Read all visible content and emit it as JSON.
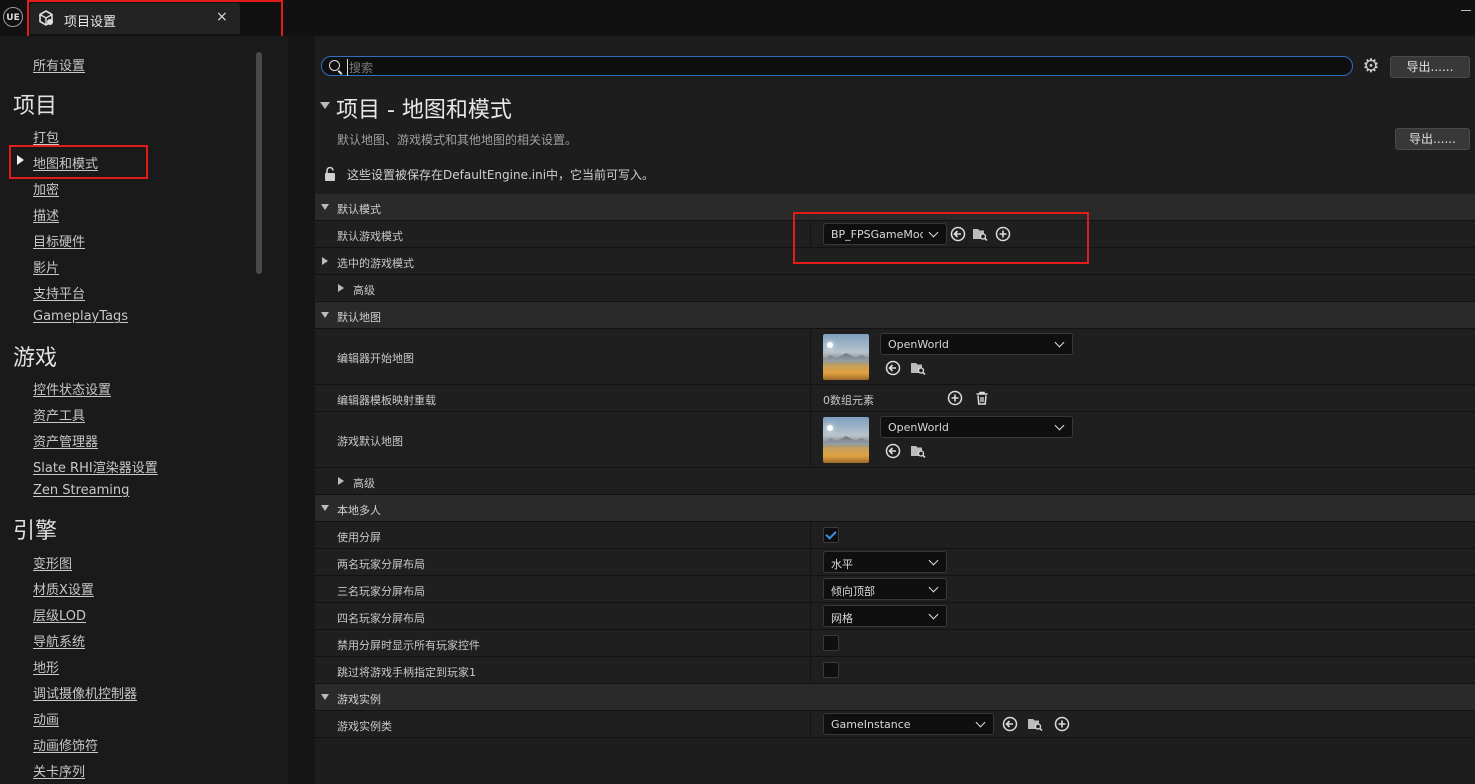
{
  "window": {
    "tab_title": "项目设置",
    "tab_close": "×",
    "logo": "UE"
  },
  "sidebar": {
    "all_settings": "所有设置",
    "sections": [
      {
        "title": "项目",
        "items": [
          "打包",
          "地图和模式",
          "加密",
          "描述",
          "目标硬件",
          "影片",
          "支持平台",
          "GameplayTags"
        ]
      },
      {
        "title": "游戏",
        "items": [
          "控件状态设置",
          "资产工具",
          "资产管理器",
          "Slate RHI渲染器设置",
          "Zen Streaming"
        ]
      },
      {
        "title": "引擎",
        "items": [
          "变形图",
          "材质X设置",
          "层级LOD",
          "导航系统",
          "地形",
          "调试摄像机控制器",
          "动画",
          "动画修饰符",
          "关卡序列"
        ]
      }
    ],
    "selected_item": "地图和模式"
  },
  "toolbar": {
    "search_placeholder": "搜索",
    "export_label": "导出......",
    "gear_icon": "settings-gear-icon"
  },
  "page": {
    "title": "项目 - 地图和模式",
    "description": "默认地图、游戏模式和其他地图的相关设置。",
    "export_label": "导出......",
    "save_note": "这些设置被保存在DefaultEngine.ini中，它当前可写入。"
  },
  "settings": {
    "default_modes": {
      "title": "默认模式",
      "default_game_mode_label": "默认游戏模式",
      "default_game_mode_value": "BP_FPSGameMode",
      "selected_game_mode_label": "选中的游戏模式",
      "advanced_label": "高级"
    },
    "default_maps": {
      "title": "默认地图",
      "editor_startup_map_label": "编辑器开始地图",
      "editor_startup_map_value": "OpenWorld",
      "editor_template_label": "编辑器模板映射重载",
      "editor_template_value": "0数组元素",
      "game_default_map_label": "游戏默认地图",
      "game_default_map_value": "OpenWorld",
      "advanced_label": "高级"
    },
    "local_multiplayer": {
      "title": "本地多人",
      "use_splitscreen_label": "使用分屏",
      "use_splitscreen_checked": true,
      "two_player_label": "两名玩家分屏布局",
      "two_player_value": "水平",
      "three_player_label": "三名玩家分屏布局",
      "three_player_value": "倾向顶部",
      "four_player_label": "四名玩家分屏布局",
      "four_player_value": "网格",
      "disable_splitscreen_label": "禁用分屏时显示所有玩家控件",
      "disable_splitscreen_checked": false,
      "skip_gamepad_label": "跳过将游戏手柄指定到玩家1",
      "skip_gamepad_checked": false
    },
    "game_instance": {
      "title": "游戏实例",
      "class_label": "游戏实例类",
      "class_value": "GameInstance"
    }
  },
  "colors": {
    "accent_blue": "#2d6fc1",
    "highlight_red": "#e21b1b",
    "checkmark_blue": "#3f8fe8"
  }
}
